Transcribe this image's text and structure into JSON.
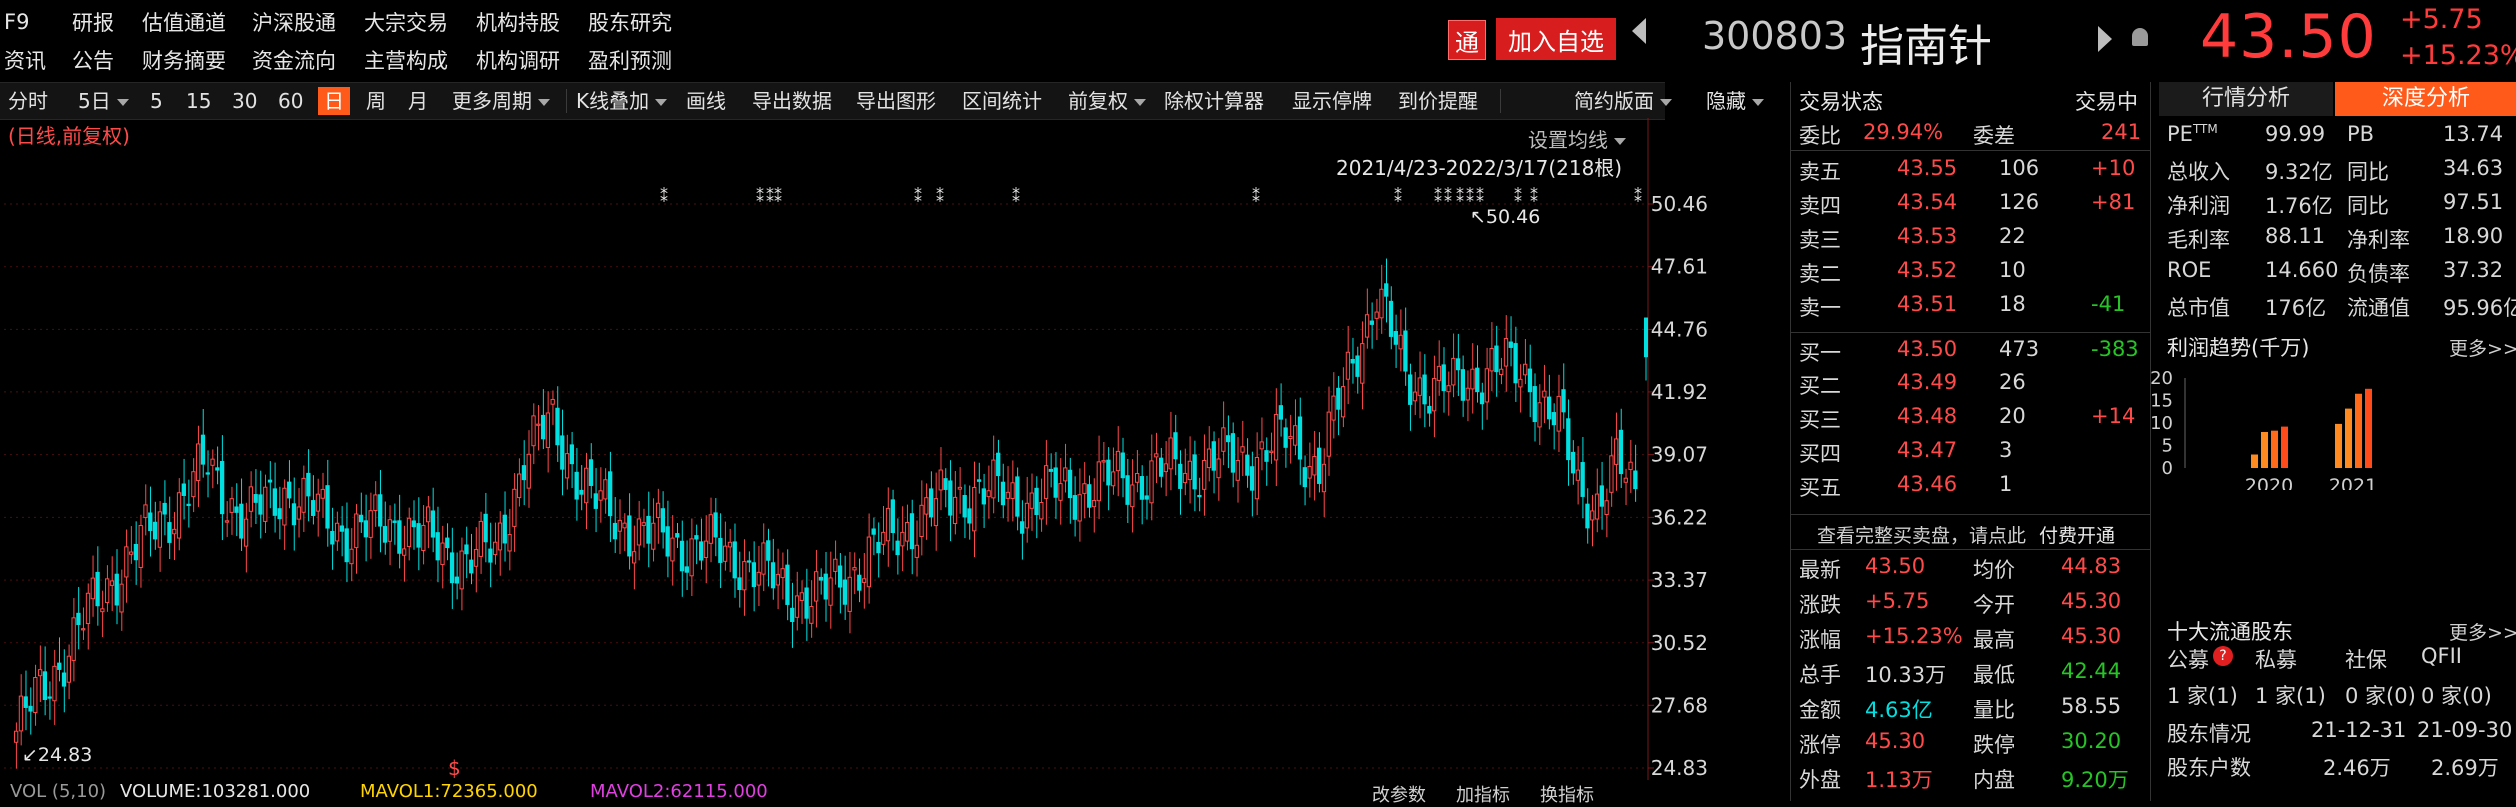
{
  "menu": {
    "row1": [
      "F9",
      "研报",
      "估值通道",
      "沪深股通",
      "大宗交易",
      "机构持股",
      "股东研究"
    ],
    "row2": [
      "资讯",
      "公告",
      "财务摘要",
      "资金流向",
      "主营构成",
      "机构调研",
      "盈利预测"
    ]
  },
  "header": {
    "tong": "通",
    "add_fav": "加入自选",
    "code": "300803",
    "name": "指南针",
    "price": "43.50",
    "change": "+5.75",
    "change_pct": "+15.23%"
  },
  "toolbar": {
    "items": [
      "分时",
      "5日",
      "5",
      "15",
      "30",
      "60",
      "日",
      "周",
      "月",
      "更多周期",
      "K线叠加",
      "画线",
      "导出数据",
      "导出图形",
      "区间统计",
      "前复权",
      "除权计算器",
      "显示停牌",
      "到价提醒",
      "简约版面",
      "隐藏"
    ]
  },
  "chart": {
    "mode_label": "(日线,前复权)",
    "ma_setting": "设置均线",
    "range_label": "2021/4/23-2022/3/17(218根)",
    "y_ticks": [
      "50.46",
      "47.61",
      "44.76",
      "41.92",
      "39.07",
      "36.22",
      "33.37",
      "30.52",
      "27.68",
      "24.83"
    ],
    "max_label": "50.46",
    "min_label": "24.83",
    "dividend_marker": "$",
    "volume_bar": {
      "vol": "VOL (5,10)",
      "volume": "VOLUME:103281.000",
      "mavol1": "MAVOL1:72365.000",
      "mavol2": "MAVOL2:62115.000",
      "btn1": "改参数",
      "btn2": "加指标",
      "btn3": "换指标"
    },
    "colors": {
      "up": "#ff4a4a",
      "down": "#00e0e0",
      "grid": "#4a0f0f"
    }
  },
  "order_book": {
    "status_label": "交易状态",
    "status_value": "交易中",
    "weibi_label": "委比",
    "weibi_value": "29.94%",
    "weicha_label": "委差",
    "weicha_value": "241",
    "asks": [
      {
        "label": "卖五",
        "price": "43.55",
        "vol": "106",
        "chg": "+10"
      },
      {
        "label": "卖四",
        "price": "43.54",
        "vol": "126",
        "chg": "+81"
      },
      {
        "label": "卖三",
        "price": "43.53",
        "vol": "22",
        "chg": ""
      },
      {
        "label": "卖二",
        "price": "43.52",
        "vol": "10",
        "chg": ""
      },
      {
        "label": "卖一",
        "price": "43.51",
        "vol": "18",
        "chg": "-41"
      }
    ],
    "bids": [
      {
        "label": "买一",
        "price": "43.50",
        "vol": "473",
        "chg": "-383"
      },
      {
        "label": "买二",
        "price": "43.49",
        "vol": "26",
        "chg": ""
      },
      {
        "label": "买三",
        "price": "43.48",
        "vol": "20",
        "chg": "+14"
      },
      {
        "label": "买四",
        "price": "43.47",
        "vol": "3",
        "chg": ""
      },
      {
        "label": "买五",
        "price": "43.46",
        "vol": "1",
        "chg": ""
      }
    ],
    "full_book_notice": "查看完整买卖盘，请点此",
    "pay_link": "付费开通",
    "stats": [
      {
        "l1": "最新",
        "v1": "43.50",
        "l2": "均价",
        "v2": "44.83"
      },
      {
        "l1": "涨跌",
        "v1": "+5.75",
        "l2": "今开",
        "v2": "45.30"
      },
      {
        "l1": "涨幅",
        "v1": "+15.23%",
        "l2": "最高",
        "v2": "45.30"
      },
      {
        "l1": "总手",
        "v1": "10.33万",
        "l2": "最低",
        "v2": "42.44"
      },
      {
        "l1": "金额",
        "v1": "4.63亿",
        "l2": "量比",
        "v2": "58.55"
      },
      {
        "l1": "涨停",
        "v1": "45.30",
        "l2": "跌停",
        "v2": "30.20"
      },
      {
        "l1": "外盘",
        "v1": "1.13万",
        "l2": "内盘",
        "v2": "9.20万"
      }
    ]
  },
  "right_panel": {
    "tab1": "行情分析",
    "tab2": "深度分析",
    "fin": [
      {
        "l1": "PE",
        "sup": "TTM",
        "v1": "99.99",
        "l2": "PB",
        "v2": "13.74"
      },
      {
        "l1": "总收入",
        "v1": "9.32亿",
        "l2": "同比",
        "v2": "34.63"
      },
      {
        "l1": "净利润",
        "v1": "1.76亿",
        "l2": "同比",
        "v2": "97.51"
      },
      {
        "l1": "毛利率",
        "v1": "88.11",
        "l2": "净利率",
        "v2": "18.90"
      },
      {
        "l1": "ROE",
        "v1": "14.660",
        "l2": "负债率",
        "v2": "37.32"
      },
      {
        "l1": "总市值",
        "v1": "176亿",
        "l2": "流通值",
        "v2": "95.96亿"
      }
    ],
    "profit_title": "利润趋势(千万)",
    "more1": "更多>>",
    "holders_title": "十大流通股东",
    "more2": "更多>>",
    "holder_types": [
      "公募",
      "私募",
      "社保",
      "QFII"
    ],
    "holder_counts": [
      "1 家(1)",
      "1 家(1)",
      "0 家(0)",
      "0 家(0)"
    ],
    "holders_row_label": "股东情况",
    "holders_date1": "21-12-31",
    "holders_date2": "21-09-30",
    "holders_count_label": "股东户数",
    "holders_count1": "2.46万",
    "holders_count2": "2.69万",
    "chart_data": {
      "type": "bar",
      "categories": [
        "2020",
        "2021"
      ],
      "ylim": [
        0,
        20
      ],
      "yticks": [
        "0",
        "5",
        "10",
        "15",
        "20"
      ],
      "series": [
        {
          "values_2020": [
            3,
            8,
            8.3,
            9.2
          ]
        },
        {
          "values_2021": [
            9.8,
            13.2,
            16.5,
            17.6
          ]
        }
      ]
    }
  }
}
